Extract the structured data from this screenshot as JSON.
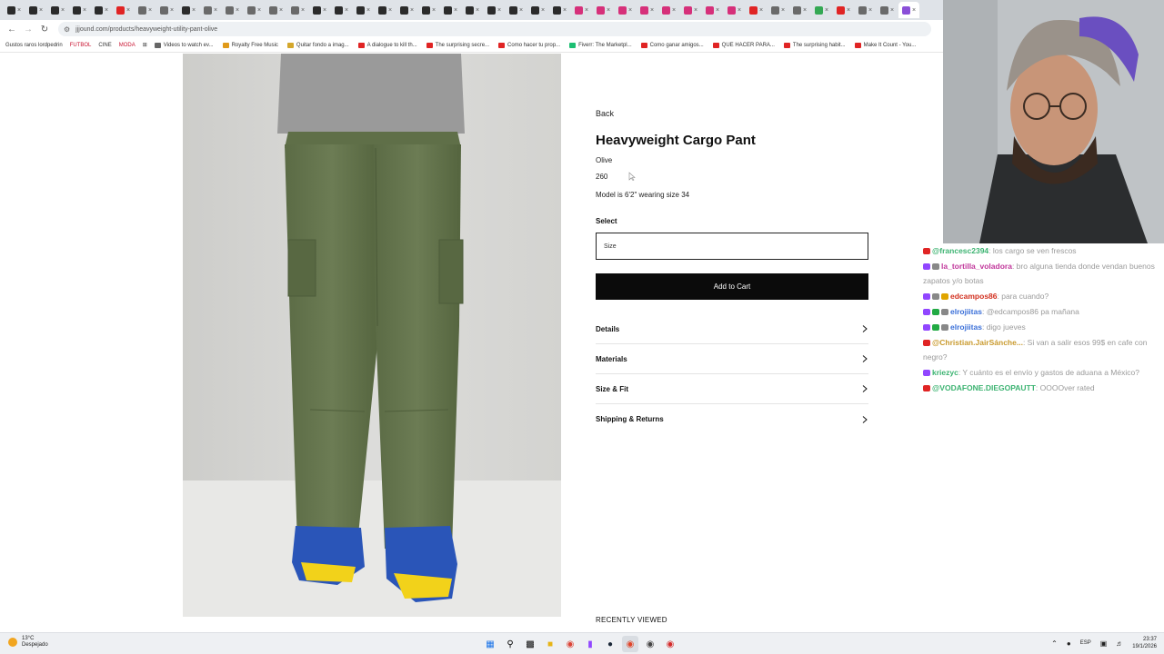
{
  "browser": {
    "url": "jjjound.com/products/heavyweight-utility-pant-olive",
    "bookmarks": [
      {
        "label": "Gustos raros lordpedrin",
        "color": "#888888",
        "style": "plain"
      },
      {
        "label": "FUTBOL",
        "color": "#c8102e",
        "style": "red"
      },
      {
        "label": "CINE",
        "color": "#888888",
        "style": "plain"
      },
      {
        "label": "MODA",
        "color": "#c8102e",
        "style": "red"
      },
      {
        "label": "Videos to watch ev...",
        "color": "#666666",
        "style": "folder"
      },
      {
        "label": "Royalty Free Music",
        "color": "#e09a1a",
        "style": "icon"
      },
      {
        "label": "Quitar fondo a imag...",
        "color": "#d4a72c",
        "style": "icon"
      },
      {
        "label": "A dialogue to kill th...",
        "color": "#e02424",
        "style": "icon"
      },
      {
        "label": "The surprising secre...",
        "color": "#e02424",
        "style": "icon"
      },
      {
        "label": "Como hacer tu prop...",
        "color": "#e02424",
        "style": "icon"
      },
      {
        "label": "Fiverr: The Marketpl...",
        "color": "#1dbf73",
        "style": "icon"
      },
      {
        "label": "Como ganar amigos...",
        "color": "#e02424",
        "style": "icon"
      },
      {
        "label": "QUE HACER PARA...",
        "color": "#e02424",
        "style": "icon"
      },
      {
        "label": "The surprising habit...",
        "color": "#e02424",
        "style": "icon"
      },
      {
        "label": "Make It Count - You...",
        "color": "#e02424",
        "style": "icon"
      }
    ]
  },
  "product": {
    "back": "Back",
    "title": "Heavyweight Cargo Pant",
    "color": "Olive",
    "price": "260",
    "model_note": "Model is 6'2\" wearing size 34",
    "select_label": "Select",
    "size_placeholder": "Size",
    "add_to_cart": "Add to Cart",
    "accordion": [
      "Details",
      "Materials",
      "Size & Fit",
      "Shipping & Returns"
    ],
    "recently_viewed": "RECENTLY VIEWED"
  },
  "chat": [
    {
      "user": "@francesc2394",
      "text": ": los cargo se ven frescos",
      "color": "#3cb371",
      "badges": [
        "#e02424"
      ]
    },
    {
      "user": "la_tortilla_voladora",
      "text": ": bro alguna tienda donde vendan buenos zapatos y/o botas",
      "color": "#c1379b",
      "badges": [
        "#9146ff",
        "#888888"
      ]
    },
    {
      "user": "edcampos86",
      "text": ": para cuando?",
      "color": "#d2301f",
      "badges": [
        "#9146ff",
        "#888888",
        "#e0a500"
      ]
    },
    {
      "user": "elrojiitas",
      "text": ": @edcampos86 pa mañana",
      "color": "#3a6fd8",
      "badges": [
        "#9146ff",
        "#22aa44",
        "#888888"
      ]
    },
    {
      "user": "elrojiitas",
      "text": ": digo jueves",
      "color": "#3a6fd8",
      "badges": [
        "#9146ff",
        "#22aa44",
        "#888888"
      ]
    },
    {
      "user": "@Christian.JairSánche...",
      "text": ": Si van a salir esos 99$ en cafe con negro?",
      "color": "#c99a2e",
      "badges": [
        "#e02424"
      ]
    },
    {
      "user": "kriezyc",
      "text": ": Y cuánto es el envío y gastos de aduana a México?",
      "color": "#3cb371",
      "badges": [
        "#9146ff"
      ]
    },
    {
      "user": "@VODAFONE.DIEGOPAUTT",
      "text": ": OOOOver rated",
      "color": "#3cb371",
      "badges": [
        "#e02424"
      ]
    }
  ],
  "taskbar": {
    "temperature": "13°C",
    "weather": "Despejado",
    "lang": "ESP",
    "time": "23:37",
    "date": "19/1/2026"
  }
}
